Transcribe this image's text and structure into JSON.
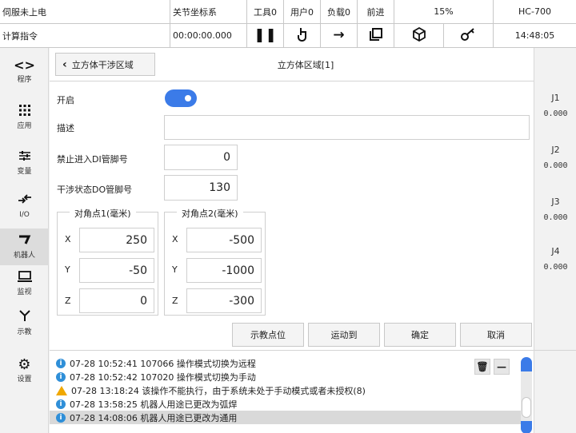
{
  "status": {
    "servo": "伺服未上电",
    "coord": "关节坐标系",
    "tool": "工具0",
    "user": "用户0",
    "load": "负载0",
    "direction": "前进",
    "speed": "15%",
    "model": "HC-700",
    "calc": "计算指令",
    "timer": "00:00:00.000",
    "clock": "14:48:05"
  },
  "sidebar": {
    "items": [
      {
        "label": "程序",
        "icon": "code-icon"
      },
      {
        "label": "应用",
        "icon": "grid-icon"
      },
      {
        "label": "变量",
        "icon": "sliders-icon"
      },
      {
        "label": "I/O",
        "icon": "io-icon"
      },
      {
        "label": "机器人",
        "icon": "robot-icon"
      },
      {
        "label": "监视",
        "icon": "monitor-icon"
      },
      {
        "label": "示教",
        "icon": "teach-icon"
      },
      {
        "label": "设置",
        "icon": "gear-icon"
      }
    ]
  },
  "panel": {
    "back_label": "立方体干涉区域",
    "title": "立方体区域[1]",
    "enable_label": "开启",
    "enabled": true,
    "desc_label": "描述",
    "desc_value": "",
    "di_label": "禁止进入DI管脚号",
    "di_value": "0",
    "do_label": "干涉状态DO管脚号",
    "do_value": "130",
    "corner1": {
      "title": "对角点1(毫米)",
      "x_label": "X",
      "x": "250",
      "y_label": "Y",
      "y": "-50",
      "z_label": "Z",
      "z": "0"
    },
    "corner2": {
      "title": "对角点2(毫米)",
      "x_label": "X",
      "x": "-500",
      "y_label": "Y",
      "y": "-1000",
      "z_label": "Z",
      "z": "-300"
    },
    "buttons": {
      "teach": "示教点位",
      "moveto": "运动到",
      "confirm": "确定",
      "cancel": "取消"
    }
  },
  "joints": [
    {
      "name": "J1",
      "value": "0.000"
    },
    {
      "name": "J2",
      "value": "0.000"
    },
    {
      "name": "J3",
      "value": "0.000"
    },
    {
      "name": "J4",
      "value": "0.000"
    }
  ],
  "log": [
    {
      "type": "info",
      "text": "07-28 10:52:41 107066 操作模式切换为远程"
    },
    {
      "type": "info",
      "text": "07-28 10:52:42 107020 操作模式切换为手动"
    },
    {
      "type": "warning",
      "text": "07-28 13:18:24 该操作不能执行，由于系统未处于手动模式或者未授权(8)"
    },
    {
      "type": "info",
      "text": "07-28 13:58:25 机器人用途已更改为弧焊"
    },
    {
      "type": "info",
      "text": "07-28 14:08:06 机器人用途已更改为通用"
    }
  ],
  "colors": {
    "accent": "#3b7be8",
    "info": "#2f8fd8",
    "warning": "#f0a800"
  }
}
